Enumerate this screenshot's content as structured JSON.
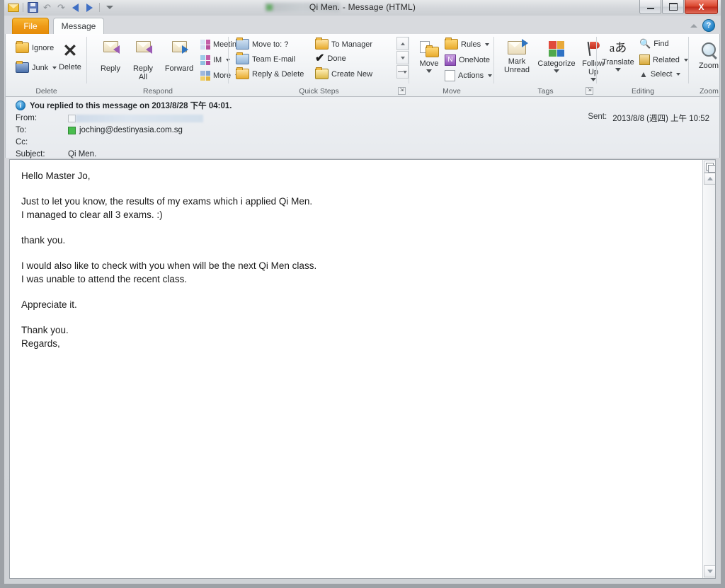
{
  "window": {
    "title": "Qi Men.  -  Message (HTML)",
    "quick_access": [
      {
        "name": "mail-icon",
        "label": "Mail"
      },
      {
        "name": "save-icon",
        "label": "Save"
      },
      {
        "name": "undo-icon",
        "label": "Undo"
      },
      {
        "name": "redo-icon",
        "label": "Redo"
      },
      {
        "name": "previous-item-icon",
        "label": "Previous Item"
      },
      {
        "name": "next-item-icon",
        "label": "Next Item"
      },
      {
        "name": "customize-qat-icon",
        "label": "Customize Quick Access Toolbar"
      }
    ],
    "controls": {
      "minimize": "Minimize",
      "maximize": "Maximize",
      "close": "X"
    },
    "help_label": "?"
  },
  "tabs": [
    {
      "label": "File",
      "active": false
    },
    {
      "label": "Message",
      "active": true
    }
  ],
  "ribbon": {
    "groups": [
      {
        "label": "Delete",
        "items": [
          {
            "label": "Ignore",
            "icon": "ignore-icon",
            "dropdown": false
          },
          {
            "label": "Junk",
            "icon": "junk-icon",
            "dropdown": true
          },
          {
            "label": "Delete",
            "icon": "delete-x-icon",
            "dropdown": false
          }
        ]
      },
      {
        "label": "Respond",
        "items": [
          {
            "label": "Reply",
            "icon": "reply-icon",
            "dropdown": false
          },
          {
            "label": "Reply\nAll",
            "icon": "reply-all-icon",
            "dropdown": false
          },
          {
            "label": "Forward",
            "icon": "forward-icon",
            "dropdown": false
          },
          {
            "label": "Meeting",
            "icon": "meeting-icon",
            "dropdown": false
          },
          {
            "label": "IM",
            "icon": "im-icon",
            "dropdown": true
          },
          {
            "label": "More",
            "icon": "more-icon",
            "dropdown": true
          }
        ]
      },
      {
        "label": "Quick Steps",
        "items": [
          {
            "label": "Move to: ?",
            "icon": "move-to-icon"
          },
          {
            "label": "Team E-mail",
            "icon": "team-email-icon"
          },
          {
            "label": "Reply & Delete",
            "icon": "reply-delete-icon"
          },
          {
            "label": "To Manager",
            "icon": "to-manager-icon"
          },
          {
            "label": "Done",
            "icon": "done-check-icon"
          },
          {
            "label": "Create New",
            "icon": "create-new-icon"
          }
        ]
      },
      {
        "label": "Move",
        "items": [
          {
            "label": "Move",
            "icon": "move-folder-icon",
            "dropdown": true
          },
          {
            "label": "Rules",
            "icon": "rules-icon",
            "dropdown": true
          },
          {
            "label": "OneNote",
            "icon": "onenote-icon",
            "dropdown": false
          },
          {
            "label": "Actions",
            "icon": "actions-icon",
            "dropdown": true
          }
        ]
      },
      {
        "label": "Tags",
        "items": [
          {
            "label": "Mark\nUnread",
            "icon": "mark-unread-icon",
            "dropdown": false
          },
          {
            "label": "Categorize",
            "icon": "categorize-icon",
            "dropdown": true
          },
          {
            "label": "Follow\nUp",
            "icon": "follow-up-flag-icon",
            "dropdown": true
          }
        ]
      },
      {
        "label": "Editing",
        "items": [
          {
            "label": "Translate",
            "icon": "translate-icon",
            "dropdown": true
          },
          {
            "label": "Find",
            "icon": "find-binoculars-icon",
            "dropdown": false
          },
          {
            "label": "Related",
            "icon": "related-icon",
            "dropdown": true
          },
          {
            "label": "Select",
            "icon": "select-cursor-icon",
            "dropdown": true
          }
        ]
      },
      {
        "label": "Zoom",
        "items": [
          {
            "label": "Zoom",
            "icon": "zoom-magnifier-icon",
            "dropdown": false
          }
        ]
      }
    ]
  },
  "message": {
    "info_bar": "You replied to this message on 2013/8/28 下午 04:01.",
    "fields": {
      "from_label": "From:",
      "from_value": "",
      "to_label": "To:",
      "to_value": "joching@destinyasia.com.sg",
      "cc_label": "Cc:",
      "cc_value": "",
      "subject_label": "Subject:",
      "subject_value": "Qi Men."
    },
    "sent_label": "Sent:",
    "sent_value": "2013/8/8 (週四) 上午 10:52",
    "body": "Hello Master Jo,\n\nJust to let you know, the results of my exams which i applied Qi Men.\nI managed to clear all 3 exams. :)\n\nthank you.\n\nI would also like to check with you when will be the next Qi Men class.\nI was unable to attend the recent class.\n\nAppreciate it.\n\nThank you.\nRegards,"
  },
  "colors": {
    "file_tab": "#ef9a16",
    "close_button": "#c0291a",
    "presence_online": "#49bd4e",
    "info_icon": "#1d7fc4"
  }
}
